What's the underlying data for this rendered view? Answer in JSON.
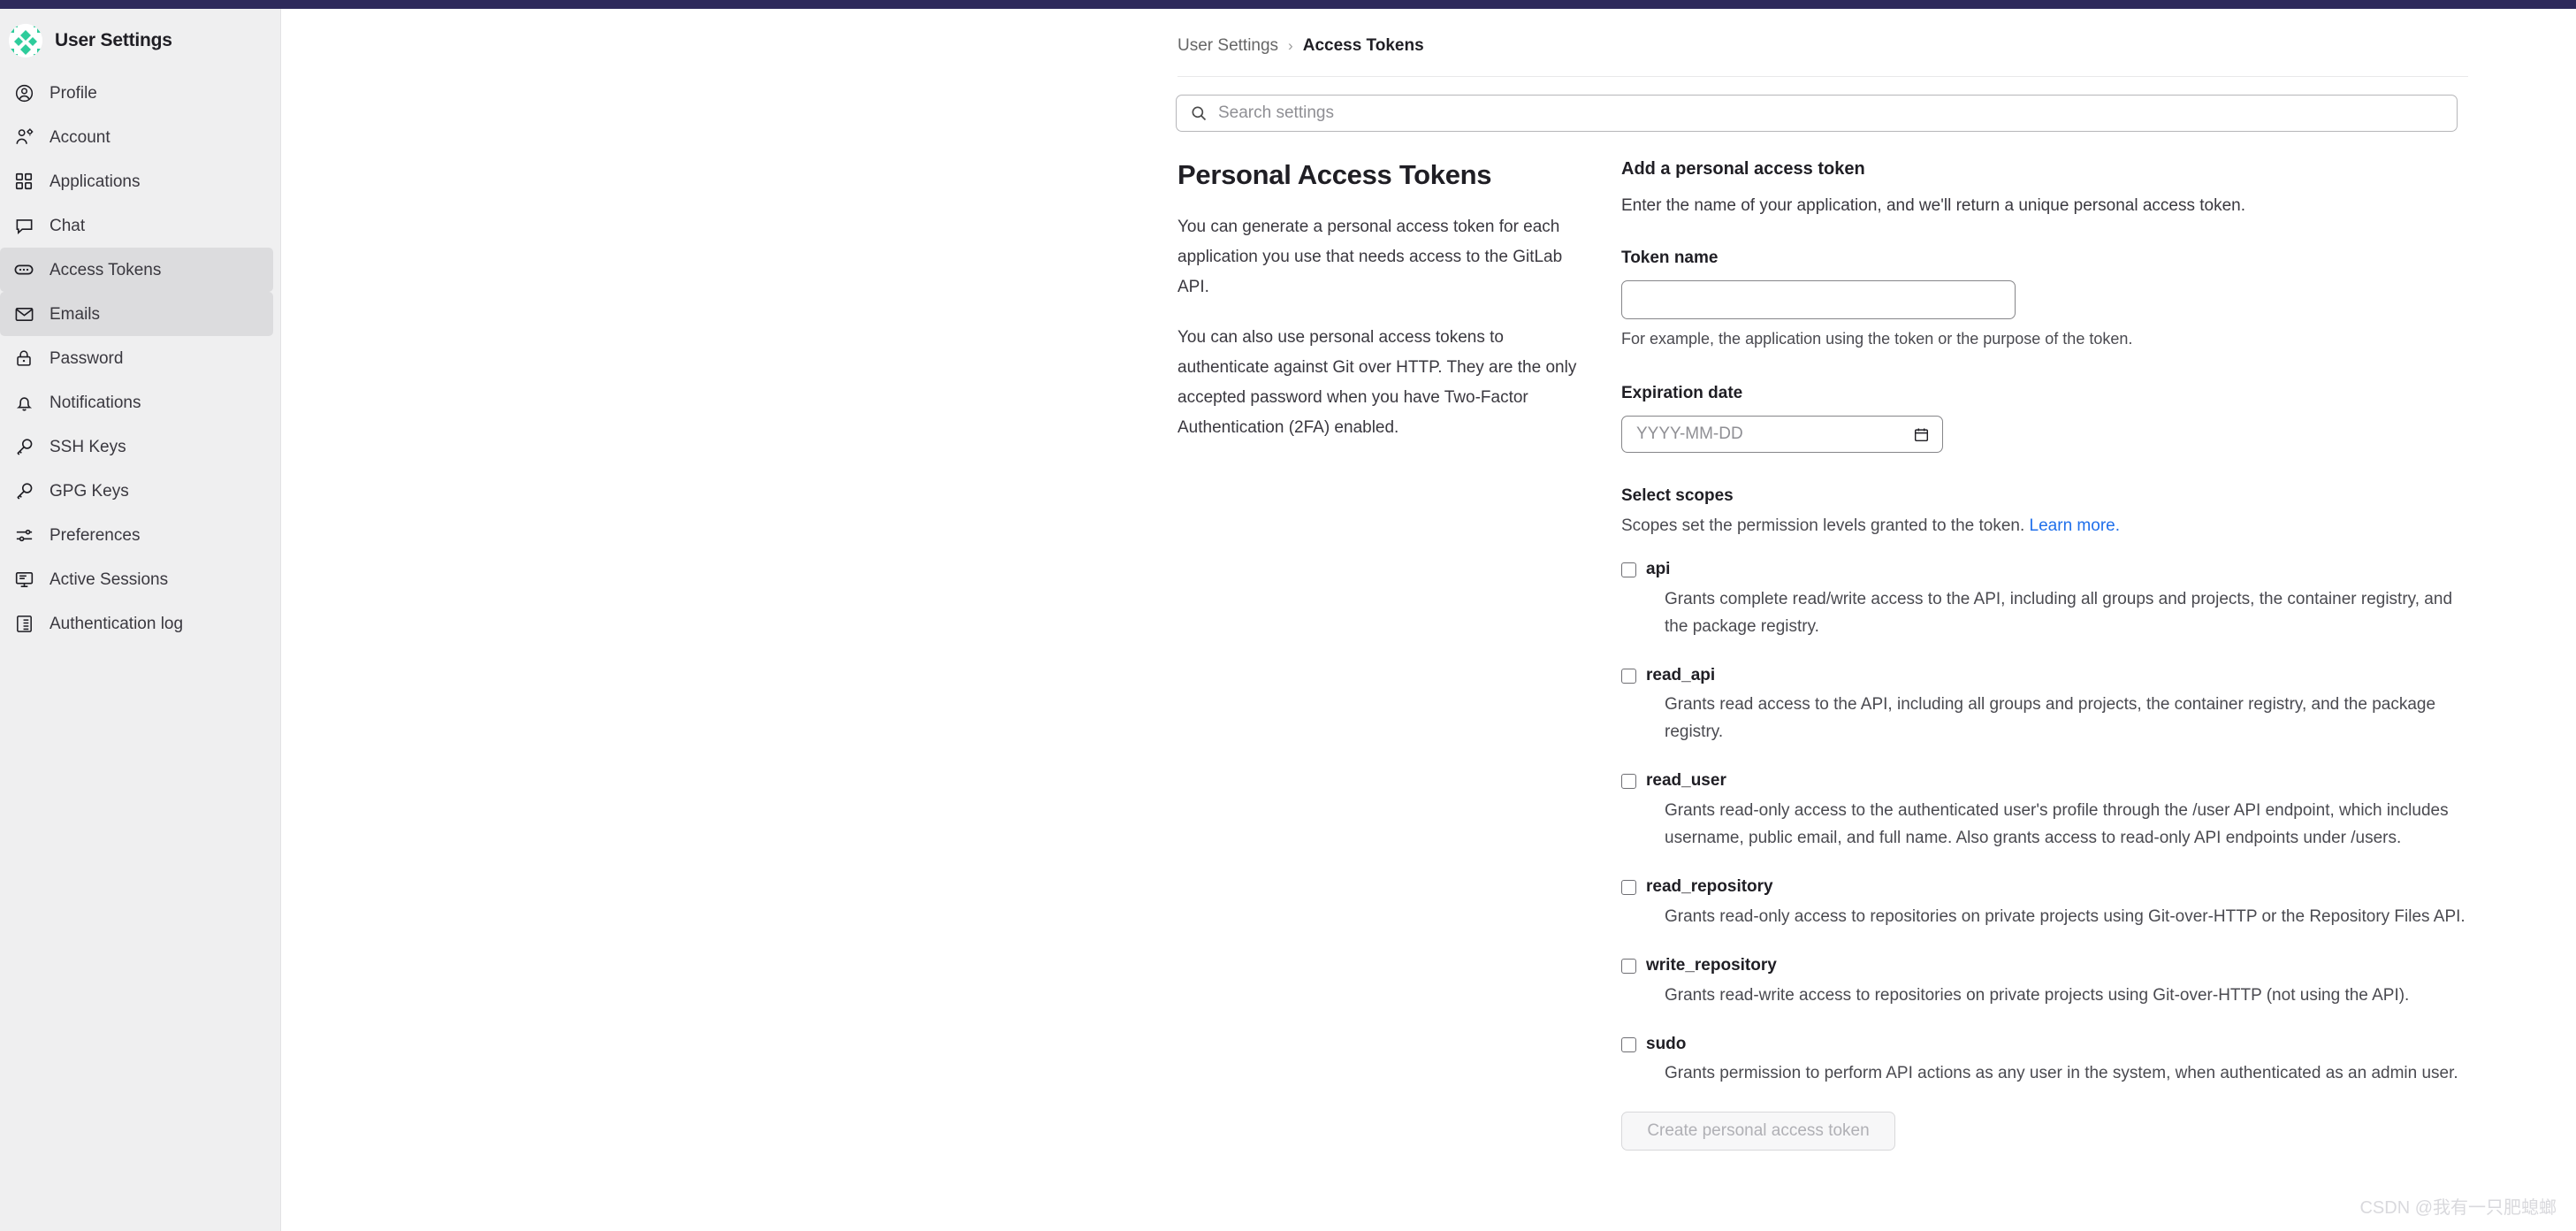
{
  "sidebar": {
    "title": "User Settings",
    "avatar_icon": "identicon-avatar",
    "items": [
      {
        "label": "Profile",
        "icon": "user-circle-icon",
        "active": false
      },
      {
        "label": "Account",
        "icon": "user-gear-icon",
        "active": false
      },
      {
        "label": "Applications",
        "icon": "grid-apps-icon",
        "active": false
      },
      {
        "label": "Chat",
        "icon": "chat-bubble-icon",
        "active": false
      },
      {
        "label": "Access Tokens",
        "icon": "token-oval-icon",
        "active": true
      },
      {
        "label": "Emails",
        "icon": "envelope-icon",
        "active": true
      },
      {
        "label": "Password",
        "icon": "lock-icon",
        "active": false
      },
      {
        "label": "Notifications",
        "icon": "bell-icon",
        "active": false
      },
      {
        "label": "SSH Keys",
        "icon": "key-icon",
        "active": false
      },
      {
        "label": "GPG Keys",
        "icon": "key-icon",
        "active": false
      },
      {
        "label": "Preferences",
        "icon": "sliders-icon",
        "active": false
      },
      {
        "label": "Active Sessions",
        "icon": "monitor-icon",
        "active": false
      },
      {
        "label": "Authentication log",
        "icon": "list-doc-icon",
        "active": false
      }
    ]
  },
  "breadcrumb": {
    "parent": "User Settings",
    "separator": "›",
    "current": "Access Tokens"
  },
  "search": {
    "placeholder": "Search settings",
    "icon": "search-icon",
    "value": ""
  },
  "intro": {
    "title": "Personal Access Tokens",
    "paragraph1": "You can generate a personal access token for each application you use that needs access to the GitLab API.",
    "paragraph2": "You can also use personal access tokens to authenticate against Git over HTTP. They are the only accepted password when you have Two-Factor Authentication (2FA) enabled."
  },
  "form": {
    "heading": "Add a personal access token",
    "subheading": "Enter the name of your application, and we'll return a unique personal access token.",
    "token_name_label": "Token name",
    "token_name_value": "",
    "token_name_placeholder": "",
    "token_name_help": "For example, the application using the token or the purpose of the token.",
    "expiration_label": "Expiration date",
    "expiration_placeholder": "YYYY-MM-DD",
    "expiration_value": "",
    "calendar_icon": "calendar-icon",
    "scopes_title": "Select scopes",
    "scopes_sub_text": "Scopes set the permission levels granted to the token.",
    "scopes_link": "Learn more.",
    "submit_label": "Create personal access token",
    "submit_disabled": true
  },
  "scopes": [
    {
      "name": "api",
      "checked": false,
      "description": "Grants complete read/write access to the API, including all groups and projects, the container registry, and the package registry."
    },
    {
      "name": "read_api",
      "checked": false,
      "description": "Grants read access to the API, including all groups and projects, the container registry, and the package registry."
    },
    {
      "name": "read_user",
      "checked": false,
      "description": "Grants read-only access to the authenticated user's profile through the /user API endpoint, which includes username, public email, and full name. Also grants access to read-only API endpoints under /users."
    },
    {
      "name": "read_repository",
      "checked": false,
      "description": "Grants read-only access to repositories on private projects using Git-over-HTTP or the Repository Files API."
    },
    {
      "name": "write_repository",
      "checked": false,
      "description": "Grants read-write access to repositories on private projects using Git-over-HTTP (not using the API)."
    },
    {
      "name": "sudo",
      "checked": false,
      "description": "Grants permission to perform API actions as any user in the system, when authenticated as an admin user."
    }
  ],
  "watermark": "CSDN @我有一只肥螅螂",
  "colors": {
    "topbar": "#2e2a5b",
    "sidebar_bg": "#efeff0",
    "sidebar_active_bg": "#dcdcde",
    "link": "#1f6feb",
    "avatar_green": "#2ecc9b"
  }
}
